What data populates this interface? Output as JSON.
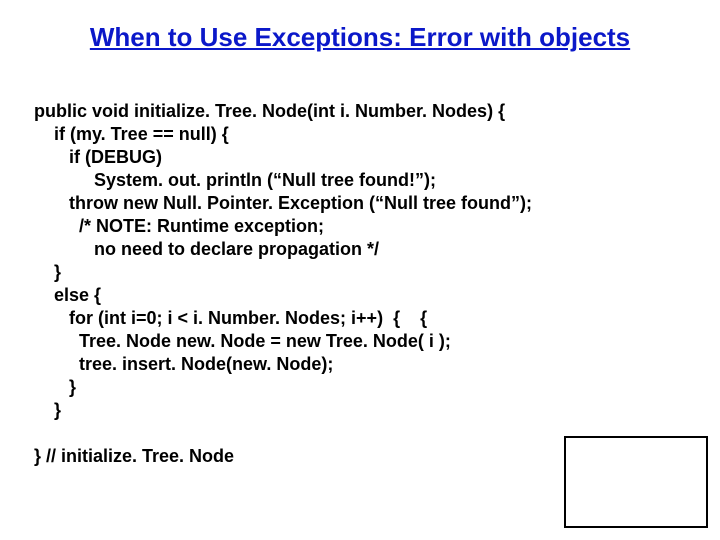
{
  "title": "When to Use Exceptions: Error with objects",
  "code": {
    "l1": "public void initialize. Tree. Node(int i. Number. Nodes) {",
    "l2": "    if (my. Tree == null) {",
    "l3": "       if (DEBUG)",
    "l4": "            System. out. println (“Null tree found!”);",
    "l5": "       throw new Null. Pointer. Exception (“Null tree found”);",
    "l6": "         /* NOTE: Runtime exception;",
    "l7": "            no need to declare propagation */",
    "l8": "    }",
    "l9": "    else {",
    "l10": "       for (int i=0; i < i. Number. Nodes; i++)  {    {",
    "l11": "         Tree. Node new. Node = new Tree. Node( i );",
    "l12": "         tree. insert. Node(new. Node);",
    "l13": "       }",
    "l14": "    }",
    "blank": "",
    "l15": "} // initialize. Tree. Node"
  }
}
